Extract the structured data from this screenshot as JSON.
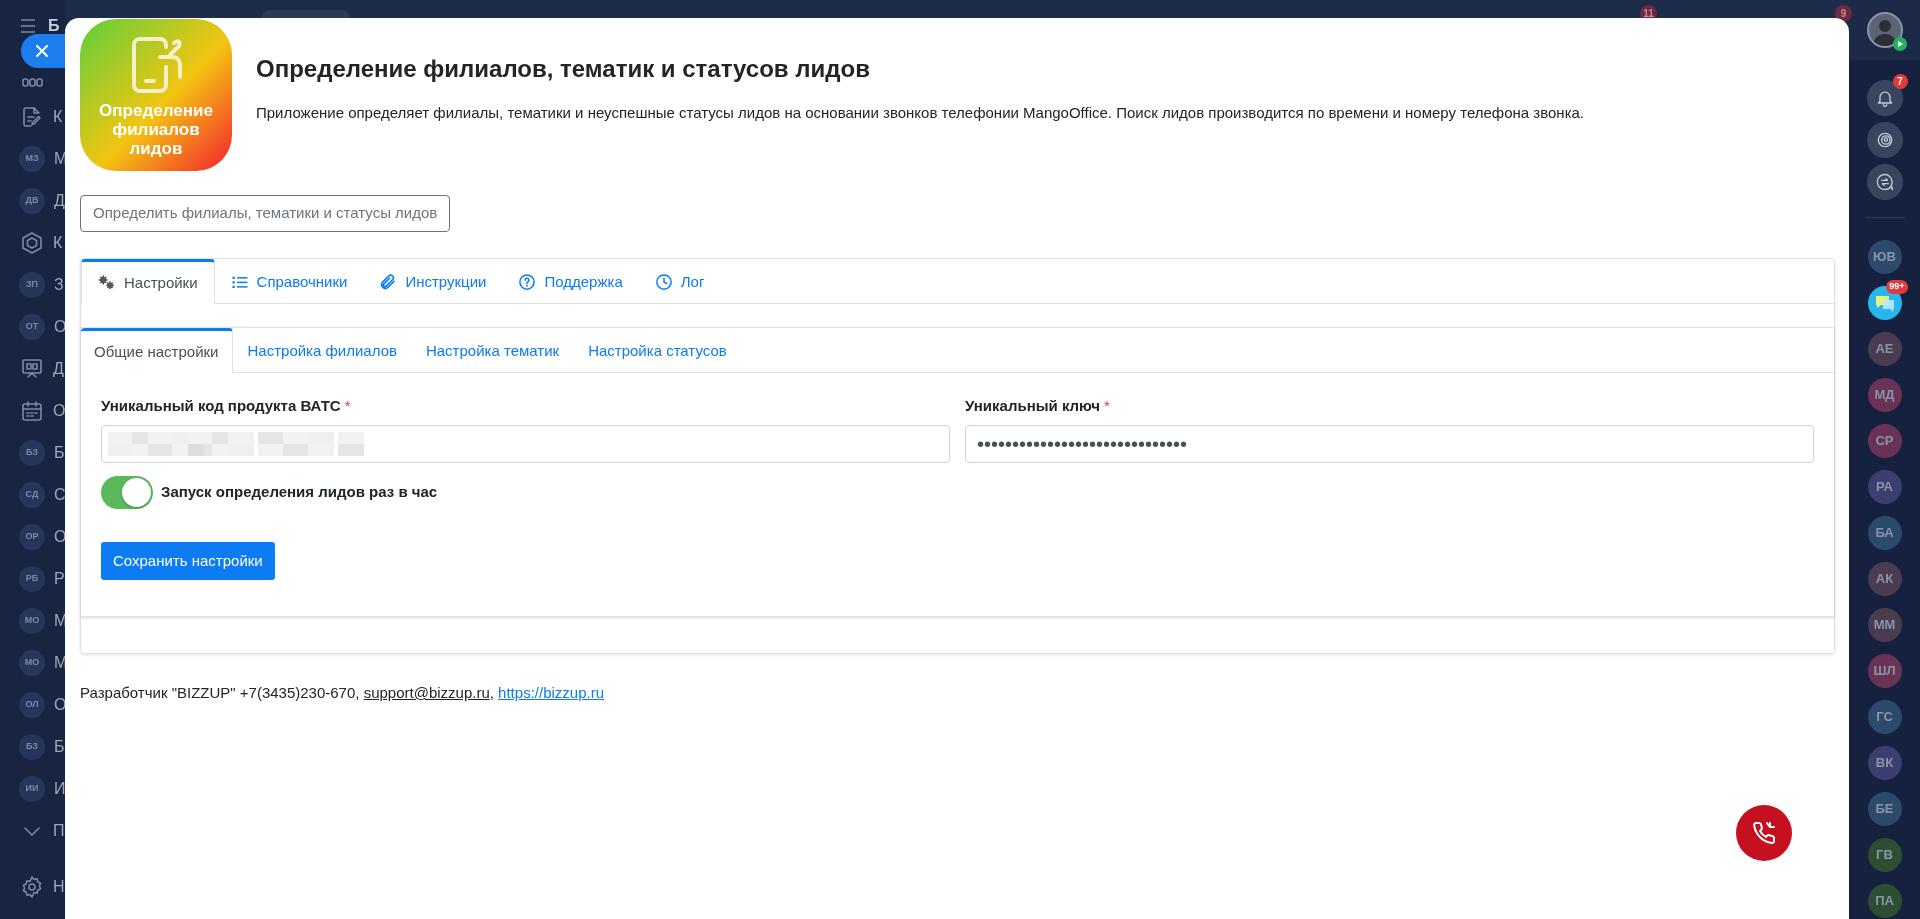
{
  "left_sidebar": {
    "header_letter": "Б",
    "items": [
      {
        "kind": "dots"
      },
      {
        "kind": "doc",
        "label": "К"
      },
      {
        "kind": "avatar",
        "initials": "МЗ",
        "label": "М"
      },
      {
        "kind": "avatar",
        "initials": "ДВ",
        "label": "Д"
      },
      {
        "kind": "hex",
        "label": "К"
      },
      {
        "kind": "avatar",
        "initials": "ЗП",
        "label": "З"
      },
      {
        "kind": "avatar",
        "initials": "ОТ",
        "label": "О"
      },
      {
        "kind": "board",
        "label": "Д"
      },
      {
        "kind": "calendar",
        "label": "О"
      },
      {
        "kind": "avatar",
        "initials": "БЗ",
        "label": "Б"
      },
      {
        "kind": "avatar",
        "initials": "СД",
        "label": "С"
      },
      {
        "kind": "avatar",
        "initials": "ОР",
        "label": "О"
      },
      {
        "kind": "avatar",
        "initials": "РБ",
        "label": "Р"
      },
      {
        "kind": "avatar",
        "initials": "МО",
        "label": "М"
      },
      {
        "kind": "avatar",
        "initials": "МО",
        "label": "М"
      },
      {
        "kind": "avatar",
        "initials": "ОЛ",
        "label": "О"
      },
      {
        "kind": "avatar",
        "initials": "БЗ",
        "label": "Б"
      },
      {
        "kind": "avatar",
        "initials": "ИИ",
        "label": "И"
      },
      {
        "kind": "chevron",
        "label": "П"
      },
      {
        "kind": "gear",
        "label": "Н"
      }
    ]
  },
  "top_bar": {
    "badges": [
      "11",
      "9"
    ]
  },
  "right_sidebar": {
    "bell_badge": "7",
    "items": [
      {
        "kind": "avatar",
        "initials": "ЮВ",
        "color": "#2c4a6b"
      },
      {
        "kind": "chat",
        "badge": "99+"
      },
      {
        "kind": "avatar",
        "initials": "АЕ",
        "color": "#4a3c50"
      },
      {
        "kind": "avatar",
        "initials": "МД",
        "color": "#6a3355"
      },
      {
        "kind": "avatar",
        "initials": "СР",
        "color": "#6a3355"
      },
      {
        "kind": "avatar",
        "initials": "РА",
        "color": "#3d3e70"
      },
      {
        "kind": "avatar",
        "initials": "БА",
        "color": "#2c4a6b"
      },
      {
        "kind": "avatar",
        "initials": "АК",
        "color": "#4a3c50"
      },
      {
        "kind": "avatar",
        "initials": "ММ",
        "color": "#4a3c50"
      },
      {
        "kind": "avatar",
        "initials": "ШЛ",
        "color": "#6a3355"
      },
      {
        "kind": "avatar",
        "initials": "ГС",
        "color": "#2c4a6b"
      },
      {
        "kind": "avatar",
        "initials": "ВК",
        "color": "#3d3e70"
      },
      {
        "kind": "avatar",
        "initials": "БЕ",
        "color": "#2c4a6b"
      },
      {
        "kind": "avatar",
        "initials": "ГВ",
        "color": "#2e4e33"
      },
      {
        "kind": "avatar",
        "initials": "ПА",
        "color": "#2e4e33"
      }
    ]
  },
  "app": {
    "icon_label": "Определение филиалов лидов",
    "title": "Определение филиалов, тематик и статусов лидов",
    "description": "Приложение определяет филиалы, тематики и неуспешные статусы лидов на основании звонков телефонии MangoOffice. Поиск лидов производится по времени и номеру телефона звонка.",
    "run_button": "Определить филиалы, тематики и статусы лидов"
  },
  "tabs": [
    {
      "label": "Настройки",
      "kind": "gears",
      "selected": true
    },
    {
      "label": "Справочники",
      "kind": "list",
      "selected": false
    },
    {
      "label": "Инструкции",
      "kind": "clip",
      "selected": false
    },
    {
      "label": "Поддержка",
      "kind": "question",
      "selected": false
    },
    {
      "label": "Лог",
      "kind": "clock",
      "selected": false
    }
  ],
  "subtabs": [
    {
      "label": "Общие настройки",
      "selected": true
    },
    {
      "label": "Настройка филиалов",
      "selected": false
    },
    {
      "label": "Настройка тематик",
      "selected": false
    },
    {
      "label": "Настройка статусов",
      "selected": false
    }
  ],
  "fields": [
    {
      "label": "Уникальный код продукта ВАТС",
      "required_mark": "*",
      "kind": "blurred"
    },
    {
      "label": "Уникальный ключ",
      "required_mark": "*",
      "kind": "password",
      "value": "••••••••••••••••••••••••••••••"
    }
  ],
  "toggle": {
    "label": "Запуск определения лидов раз в час",
    "on": true
  },
  "save_button": "Сохранить настройки",
  "footer": [
    {
      "kind": "text",
      "text": "Разработчик \"BIZZUP\" +7(3435)230-670, "
    },
    {
      "kind": "email",
      "text": "support@bizzup.ru"
    },
    {
      "kind": "text",
      "text": ", "
    },
    {
      "kind": "url",
      "text": "https://bizzup.ru"
    }
  ]
}
